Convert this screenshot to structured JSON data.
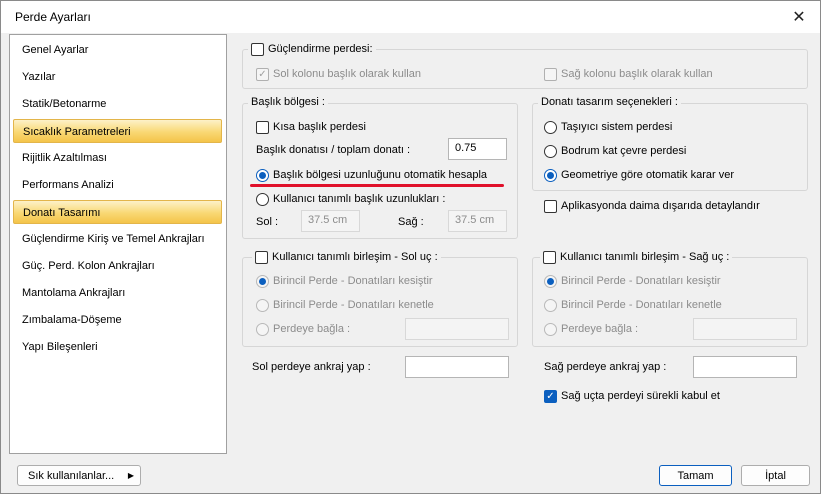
{
  "window": {
    "title": "Perde Ayarları"
  },
  "sidebar": {
    "items": [
      {
        "label": "Genel Ayarlar"
      },
      {
        "label": "Yazılar"
      },
      {
        "label": "Statik/Betonarme"
      },
      {
        "label": "Sıcaklık Parametreleri"
      },
      {
        "label": "Rijitlik Azaltılması"
      },
      {
        "label": "Performans Analizi"
      },
      {
        "label": "Donatı Tasarımı"
      },
      {
        "label": "Güçlendirme Kiriş ve Temel Ankrajları"
      },
      {
        "label": "Güç. Perd. Kolon Ankrajları"
      },
      {
        "label": "Mantolama Ankrajları"
      },
      {
        "label": "Zımbalama-Döşeme"
      },
      {
        "label": "Yapı Bileşenleri"
      }
    ]
  },
  "strengthening": {
    "label": "Güçlendirme perdesi:",
    "left_column_label": "Sol kolonu başlık olarak kullan",
    "right_column_label": "Sağ kolonu başlık olarak kullan"
  },
  "header_region": {
    "title": "Başlık bölgesi :",
    "short_header": "Kısa başlık perdesi",
    "ratio_label": "Başlık donatısı / toplam donatı :",
    "ratio_value": "0.75",
    "auto_calc": "Başlık bölgesi uzunluğunu otomatik hesapla",
    "user_defined": "Kullanıcı tanımlı başlık uzunlukları :",
    "left_label": "Sol :",
    "left_value": "37.5 cm",
    "right_label": "Sağ :",
    "right_value": "37.5 cm"
  },
  "rebar_design": {
    "title": "Donatı tasarım seçenekleri :",
    "options": [
      {
        "label": "Taşıyıcı sistem perdesi"
      },
      {
        "label": "Bodrum kat çevre perdesi"
      },
      {
        "label": "Geometriye göre otomatik karar ver"
      }
    ],
    "detail_outside": "Aplikasyonda daima dışarıda detaylandır"
  },
  "left_joint": {
    "title": "Kullanıcı tanımlı birleşim - Sol uç :",
    "opt1": "Birincil Perde - Donatıları kesiştir",
    "opt2": "Birincil Perde - Donatıları kenetle",
    "opt3": "Perdeye bağla :"
  },
  "right_joint": {
    "title": "Kullanıcı tanımlı birleşim - Sağ uç :",
    "opt1": "Birincil Perde - Donatıları kesiştir",
    "opt2": "Birincil Perde - Donatıları kenetle",
    "opt3": "Perdeye bağla :"
  },
  "anchorage": {
    "left_label": "Sol perdeye ankraj yap :",
    "right_label": "Sağ perdeye ankraj yap :",
    "continuous_label": "Sağ uçta perdeyi sürekli kabul et"
  },
  "footer": {
    "frequent_label": "Sık kullanılanlar...",
    "ok_label": "Tamam",
    "cancel_label": "İptal"
  }
}
